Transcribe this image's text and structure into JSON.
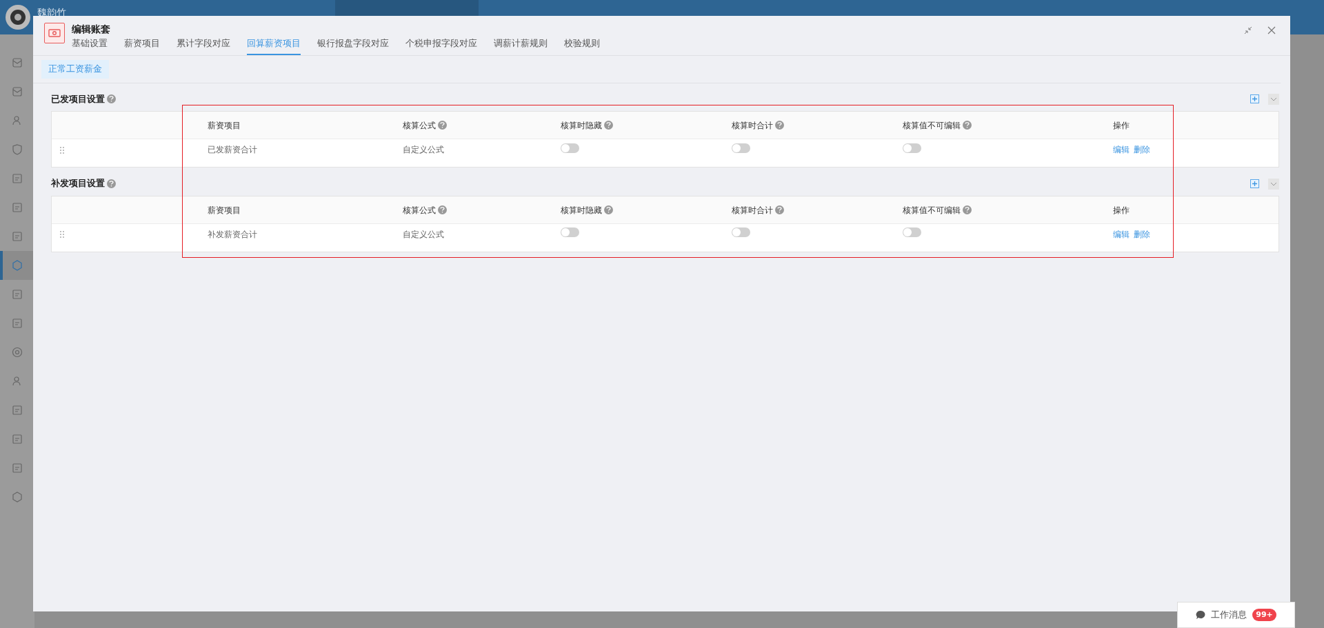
{
  "app": {
    "user": "魏韵竹",
    "sidebar": [
      {
        "selected": false
      },
      {
        "selected": false
      },
      {
        "selected": false
      },
      {
        "selected": false
      },
      {
        "selected": false
      },
      {
        "selected": false
      },
      {
        "selected": false
      },
      {
        "selected": true
      },
      {
        "selected": false
      },
      {
        "selected": false
      },
      {
        "selected": false
      },
      {
        "selected": false
      },
      {
        "selected": false
      },
      {
        "selected": false
      },
      {
        "selected": false
      },
      {
        "selected": false
      }
    ]
  },
  "modal": {
    "title": "编辑账套",
    "tabs": [
      {
        "label": "基础设置",
        "selected": false
      },
      {
        "label": "薪资项目",
        "selected": false
      },
      {
        "label": "累计字段对应",
        "selected": false
      },
      {
        "label": "回算薪资项目",
        "selected": true
      },
      {
        "label": "银行报盘字段对应",
        "selected": false
      },
      {
        "label": "个税申报字段对应",
        "selected": false
      },
      {
        "label": "调薪计薪规则",
        "selected": false
      },
      {
        "label": "校验规则",
        "selected": false
      }
    ],
    "subtabs": [
      {
        "label": "正常工资薪金",
        "selected": true
      }
    ],
    "sections": [
      {
        "title": "已发项目设置",
        "columns": [
          {
            "label": "薪资项目",
            "help": false
          },
          {
            "label": "核算公式",
            "help": true
          },
          {
            "label": "核算时隐藏",
            "help": true
          },
          {
            "label": "核算时合计",
            "help": true
          },
          {
            "label": "核算值不可编辑",
            "help": true
          },
          {
            "label": "操作",
            "help": false
          }
        ],
        "rows": [
          {
            "item": "已发薪资合计",
            "formula": "自定义公式",
            "hide_on_calc": false,
            "sum_on_calc": false,
            "not_editable": false,
            "actions": [
              "编辑",
              "删除"
            ]
          }
        ]
      },
      {
        "title": "补发项目设置",
        "columns": [
          {
            "label": "薪资项目",
            "help": false
          },
          {
            "label": "核算公式",
            "help": true
          },
          {
            "label": "核算时隐藏",
            "help": true
          },
          {
            "label": "核算时合计",
            "help": true
          },
          {
            "label": "核算值不可编辑",
            "help": true
          },
          {
            "label": "操作",
            "help": false
          }
        ],
        "rows": [
          {
            "item": "补发薪资合计",
            "formula": "自定义公式",
            "hide_on_calc": false,
            "sum_on_calc": false,
            "not_editable": false,
            "actions": [
              "编辑",
              "删除"
            ]
          }
        ]
      }
    ]
  },
  "messages": {
    "label": "工作消息",
    "badge": "99+"
  }
}
